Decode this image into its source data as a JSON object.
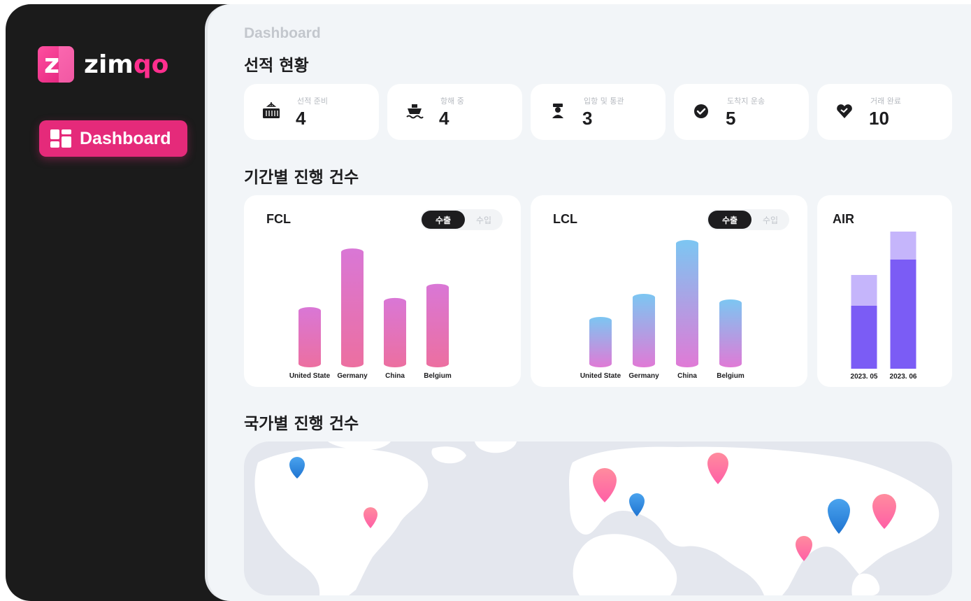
{
  "brand": {
    "name_prefix": "zim",
    "name_accent": "qo",
    "mark_letter": "z"
  },
  "sidebar": {
    "items": [
      {
        "label": "Dashboard",
        "icon": "dashboard-icon",
        "active": true
      }
    ]
  },
  "header": {
    "page_title": "Dashboard"
  },
  "shipment_status": {
    "title": "선적 현황",
    "cards": [
      {
        "label": "선적 준비",
        "value": "4",
        "icon": "container-icon"
      },
      {
        "label": "항해 중",
        "value": "4",
        "icon": "ship-icon"
      },
      {
        "label": "입항 및 통관",
        "value": "3",
        "icon": "customs-officer-icon"
      },
      {
        "label": "도착지 운송",
        "value": "5",
        "icon": "check-circle-icon"
      },
      {
        "label": "거래 완료",
        "value": "10",
        "icon": "handshake-heart-icon"
      }
    ]
  },
  "period_section": {
    "title": "기간별 진행 건수"
  },
  "toggle": {
    "export_label": "수출",
    "import_label": "수입"
  },
  "colors": {
    "accent": "#e52a7a",
    "fcl_top": "#d977d6",
    "fcl_bottom": "#ec6fa0",
    "lcl_top": "#7cc6f2",
    "lcl_bottom": "#e07ad6",
    "air_base": "#7b5cf5",
    "air_top": "#c5b5fb",
    "pin_pink": "#ff7fa6",
    "pin_blue": "#2f8be0"
  },
  "chart_data": [
    {
      "type": "bar",
      "title": "FCL",
      "categories": [
        "United State",
        "Germany",
        "China",
        "Belgium"
      ],
      "values": [
        85,
        168,
        98,
        118
      ],
      "ylim": [
        0,
        180
      ]
    },
    {
      "type": "bar",
      "title": "LCL",
      "categories": [
        "United State",
        "Germany",
        "China",
        "Belgium"
      ],
      "values": [
        72,
        105,
        182,
        97
      ],
      "ylim": [
        0,
        190
      ]
    },
    {
      "type": "bar",
      "title": "AIR",
      "categories": [
        "2023. 05",
        "2023. 06"
      ],
      "series": [
        {
          "values": [
            90,
            156
          ]
        },
        {
          "values": [
            44,
            40
          ]
        }
      ],
      "ylim": [
        0,
        200
      ]
    }
  ],
  "country_section": {
    "title": "국가별 진행 건수"
  }
}
